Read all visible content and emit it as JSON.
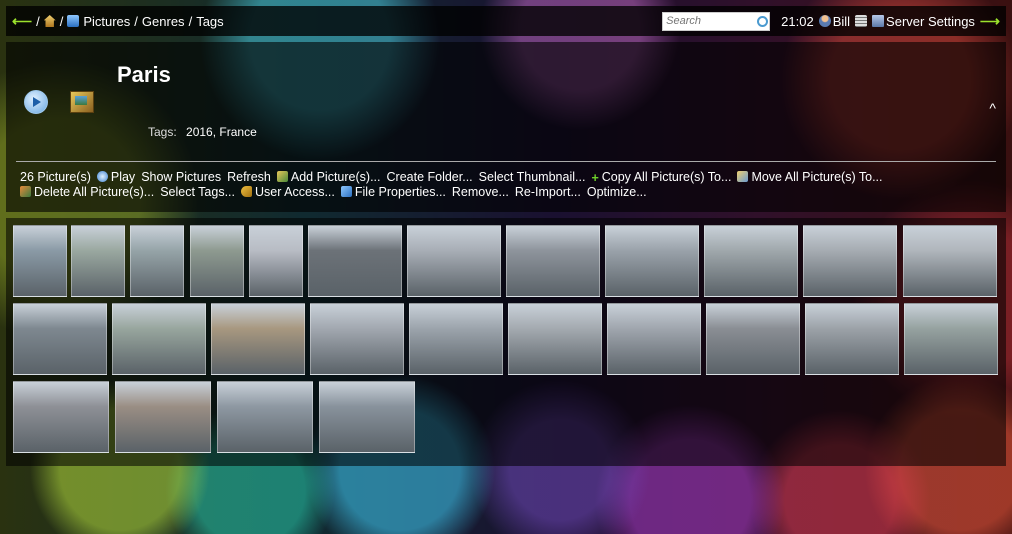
{
  "topbar": {
    "breadcrumbs": [
      "Pictures",
      "Genres",
      "Tags"
    ],
    "separator": "/",
    "back_icon": "left-arrow-icon",
    "search_placeholder": "Search",
    "time": "21:02",
    "user": "Bill",
    "server_settings": "Server Settings",
    "forward_icon": "right-arrow-icon"
  },
  "header": {
    "title": "Paris",
    "tags_label": "Tags:",
    "tags_value": "2016, France",
    "collapse": "^"
  },
  "actions": [
    {
      "label": "26 Picture(s)",
      "icon": ""
    },
    {
      "label": "Play",
      "icon": "play-icon"
    },
    {
      "label": "Show Pictures",
      "icon": ""
    },
    {
      "label": "Refresh",
      "icon": ""
    },
    {
      "label": "Add Picture(s)...",
      "icon": "add-picture-icon"
    },
    {
      "label": "Create Folder...",
      "icon": ""
    },
    {
      "label": "Select Thumbnail...",
      "icon": ""
    },
    {
      "label": "Copy All Picture(s) To...",
      "icon": "plus-icon"
    },
    {
      "label": "Move All Picture(s) To...",
      "icon": "move-icon"
    },
    {
      "label": "Delete All Picture(s)...",
      "icon": "delete-icon"
    },
    {
      "label": "Select Tags...",
      "icon": ""
    },
    {
      "label": "User Access...",
      "icon": "key-icon"
    },
    {
      "label": "File Properties...",
      "icon": "properties-icon"
    },
    {
      "label": "Remove...",
      "icon": ""
    },
    {
      "label": "Re-Import...",
      "icon": ""
    },
    {
      "label": "Optimize...",
      "icon": ""
    }
  ],
  "colors": {
    "accent_green": "#9be22c",
    "panel_bg": "#000000"
  },
  "thumbnails": [
    {
      "tone": "#8a9aa6"
    },
    {
      "tone": "#9aa8a0"
    },
    {
      "tone": "#96a4a8"
    },
    {
      "tone": "#8e9a90"
    },
    {
      "tone": "#b8bcc4"
    },
    {
      "tone": "#6c7278"
    },
    {
      "tone": "#a8aeb6"
    },
    {
      "tone": "#8e949c"
    },
    {
      "tone": "#9aa2aa"
    },
    {
      "tone": "#a0a8ac"
    },
    {
      "tone": "#a6acb2"
    },
    {
      "tone": "#b0b6bc"
    },
    {
      "tone": "#7e8890"
    },
    {
      "tone": "#98a69e"
    },
    {
      "tone": "#a89880"
    },
    {
      "tone": "#a2a8b0"
    },
    {
      "tone": "#9ca4ac"
    },
    {
      "tone": "#a4aab0"
    },
    {
      "tone": "#a0a6ae"
    },
    {
      "tone": "#8a8e94"
    },
    {
      "tone": "#9ca2a8"
    },
    {
      "tone": "#96a2a0"
    },
    {
      "tone": "#8e9096"
    },
    {
      "tone": "#9a8e84"
    },
    {
      "tone": "#8e98a2"
    },
    {
      "tone": "#88929c"
    }
  ]
}
